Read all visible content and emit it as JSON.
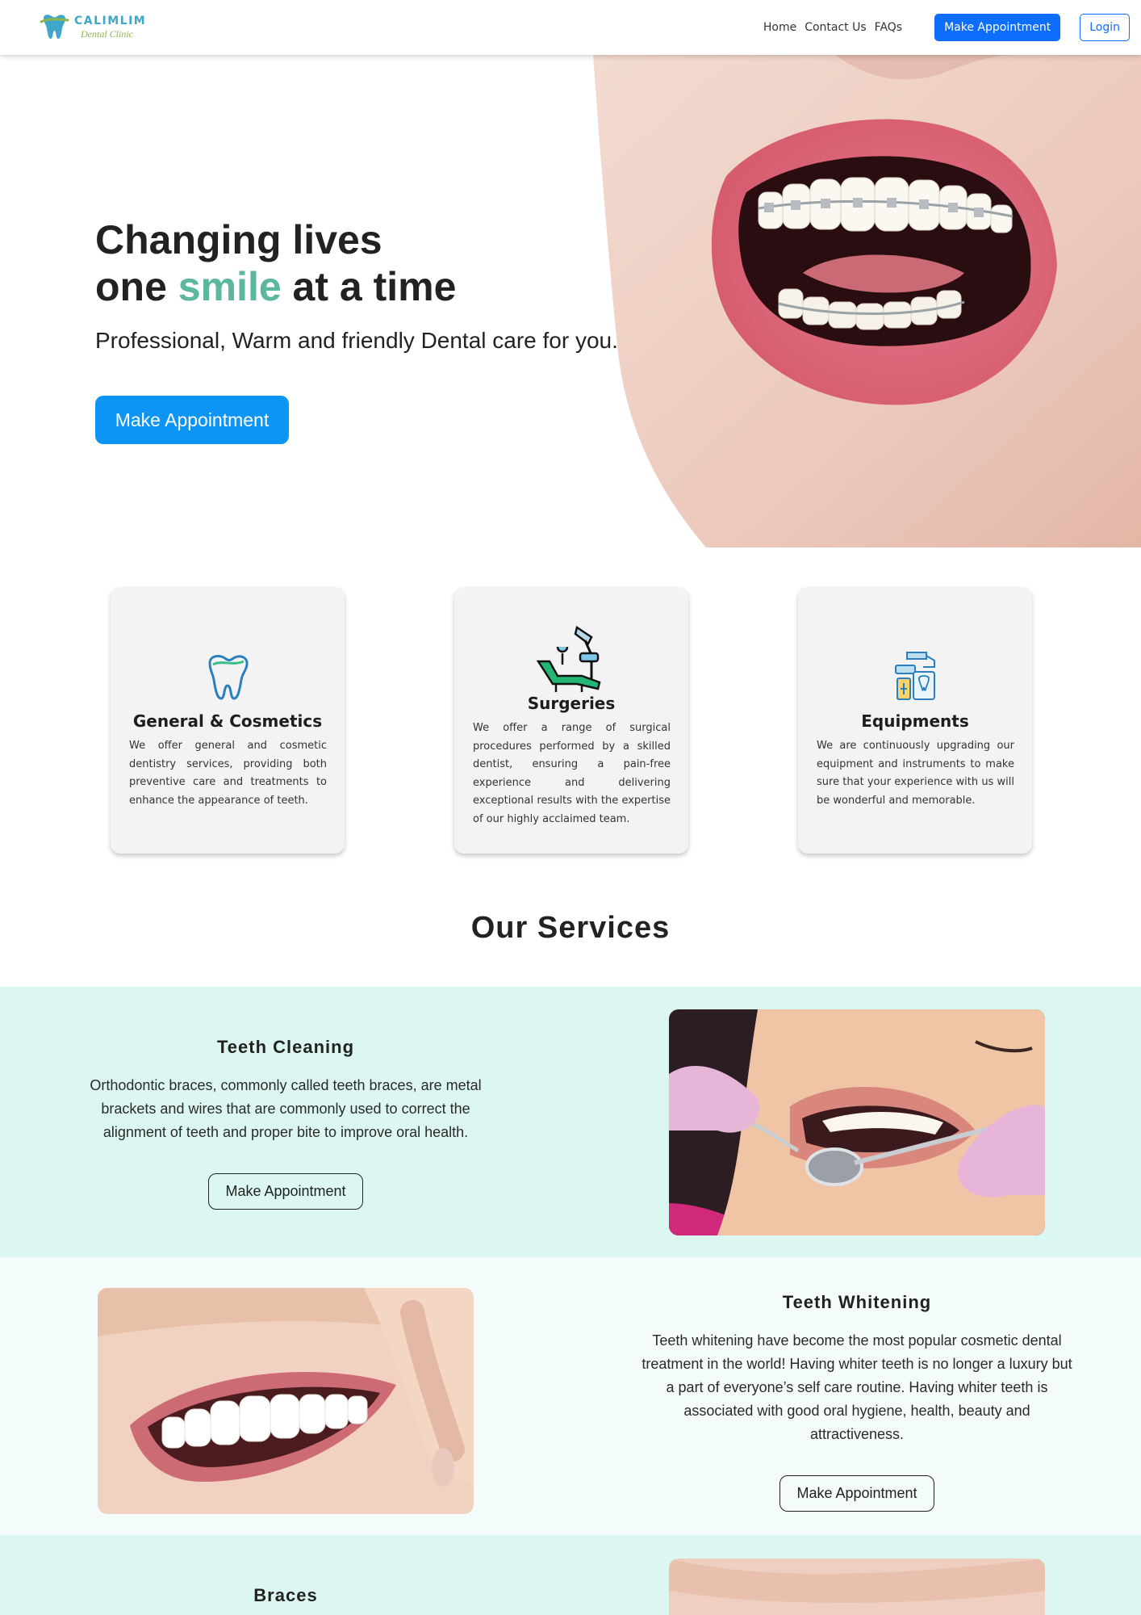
{
  "brand": {
    "name": "CALIMLIM",
    "tagline": "Dental Clinic"
  },
  "nav": {
    "links": [
      "Home",
      "Contact Us",
      "FAQs"
    ],
    "appointment_label": "Make Appointment",
    "login_label": "Login"
  },
  "hero": {
    "title_line1": "Changing lives",
    "title_line2_before": "one ",
    "title_highlight": "smile",
    "title_line2_after": " at a time",
    "subtitle": "Professional, Warm and friendly Dental care for you.",
    "button_label": "Make Appointment"
  },
  "features": [
    {
      "icon": "tooth-icon",
      "title": "General & Cosmetics",
      "text": "We offer general and cosmetic dentistry services, providing both preventive care and treatments to enhance the appearance of teeth."
    },
    {
      "icon": "dental-chair-icon",
      "title": "Surgeries",
      "text": "We offer a range of surgical procedures performed by a skilled dentist, ensuring a pain-free experience and delivering exceptional results with the expertise of our highly acclaimed team."
    },
    {
      "icon": "dental-equipment-icon",
      "title": "Equipments",
      "text": "We are continuously upgrading our equipment and instruments to make sure that your experience with us will be wonderful and memorable."
    }
  ],
  "services": {
    "heading": "Our Services",
    "items": [
      {
        "name": "Teeth Cleaning",
        "description": "Orthodontic braces, commonly called teeth braces, are metal brackets and wires that are commonly used to correct the alignment of teeth and proper bite to improve oral health.",
        "button_label": "Make Appointment"
      },
      {
        "name": "Teeth Whitening",
        "description": "Teeth whitening have become the most popular cosmetic dental treatment in the world! Having whiter teeth is no longer a luxury but a part of everyone’s self care routine. Having whiter teeth is associated with good oral hygiene, health, beauty and attractiveness.",
        "button_label": "Make Appointment"
      },
      {
        "name": "Braces"
      }
    ]
  },
  "colors": {
    "primary": "#0d6efd",
    "hero_button": "#0d95f5",
    "band_light": "#dcf7f2",
    "band_lighter": "#f3fcfa",
    "smile_gradient_start": "#4ab3b8",
    "smile_gradient_end": "#8cc35f",
    "card_bg": "#f3f3f3"
  }
}
